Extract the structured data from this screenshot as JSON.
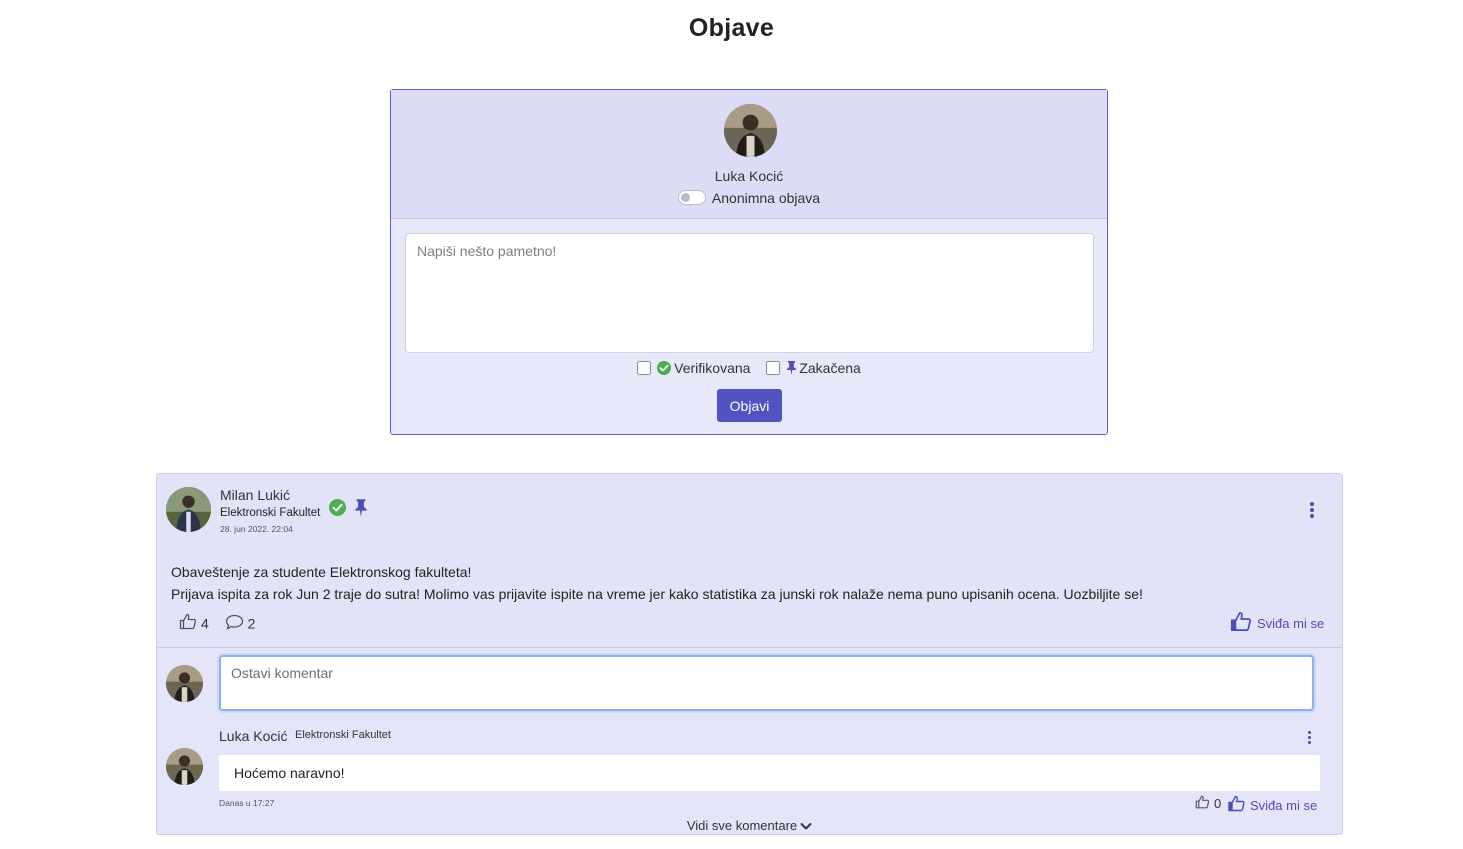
{
  "page": {
    "title": "Objave"
  },
  "composer": {
    "user_name": "Luka Kocić",
    "anonymous_label": "Anonimna objava",
    "anonymous_on": false,
    "placeholder": "Napiši nešto pametno!",
    "verified_label": "Verifikovana",
    "pinned_label": "Zakačena",
    "submit_label": "Objavi"
  },
  "post": {
    "author": "Milan Lukić",
    "faculty": "Elektronski Fakultet",
    "date": "28. jun 2022. 22:04",
    "verified": true,
    "pinned": true,
    "lines": [
      "Obaveštenje za studente Elektronskog fakulteta!",
      "Prijava ispita za rok Jun 2 traje do sutra! Molimo vas prijavite ispite na vreme jer kako statistika za junski rok nalaže nema puno upisanih ocena. Uozbiljite se!"
    ],
    "likes": "4",
    "comments": "2",
    "like_label": "Sviđa mi se"
  },
  "comment_box": {
    "placeholder": "Ostavi komentar"
  },
  "comments": [
    {
      "author": "Luka Kocić",
      "faculty": "Elektronski Fakultet",
      "text": "Hoćemo naravno!",
      "date": "Danas u 17:27",
      "likes": "0",
      "like_label": "Sviđa mi se"
    }
  ],
  "see_all_label": "Vidi sve komentare",
  "colors": {
    "accent": "#5153c0",
    "card_bg": "#e5e5f9",
    "verified_green": "#4caf50"
  },
  "icons": {
    "verified": "check-circle-icon",
    "pin": "pin-icon",
    "like": "thumbs-up-icon",
    "comment": "speech-bubble-icon",
    "more": "kebab-icon",
    "expand": "chevron-down-icon"
  }
}
